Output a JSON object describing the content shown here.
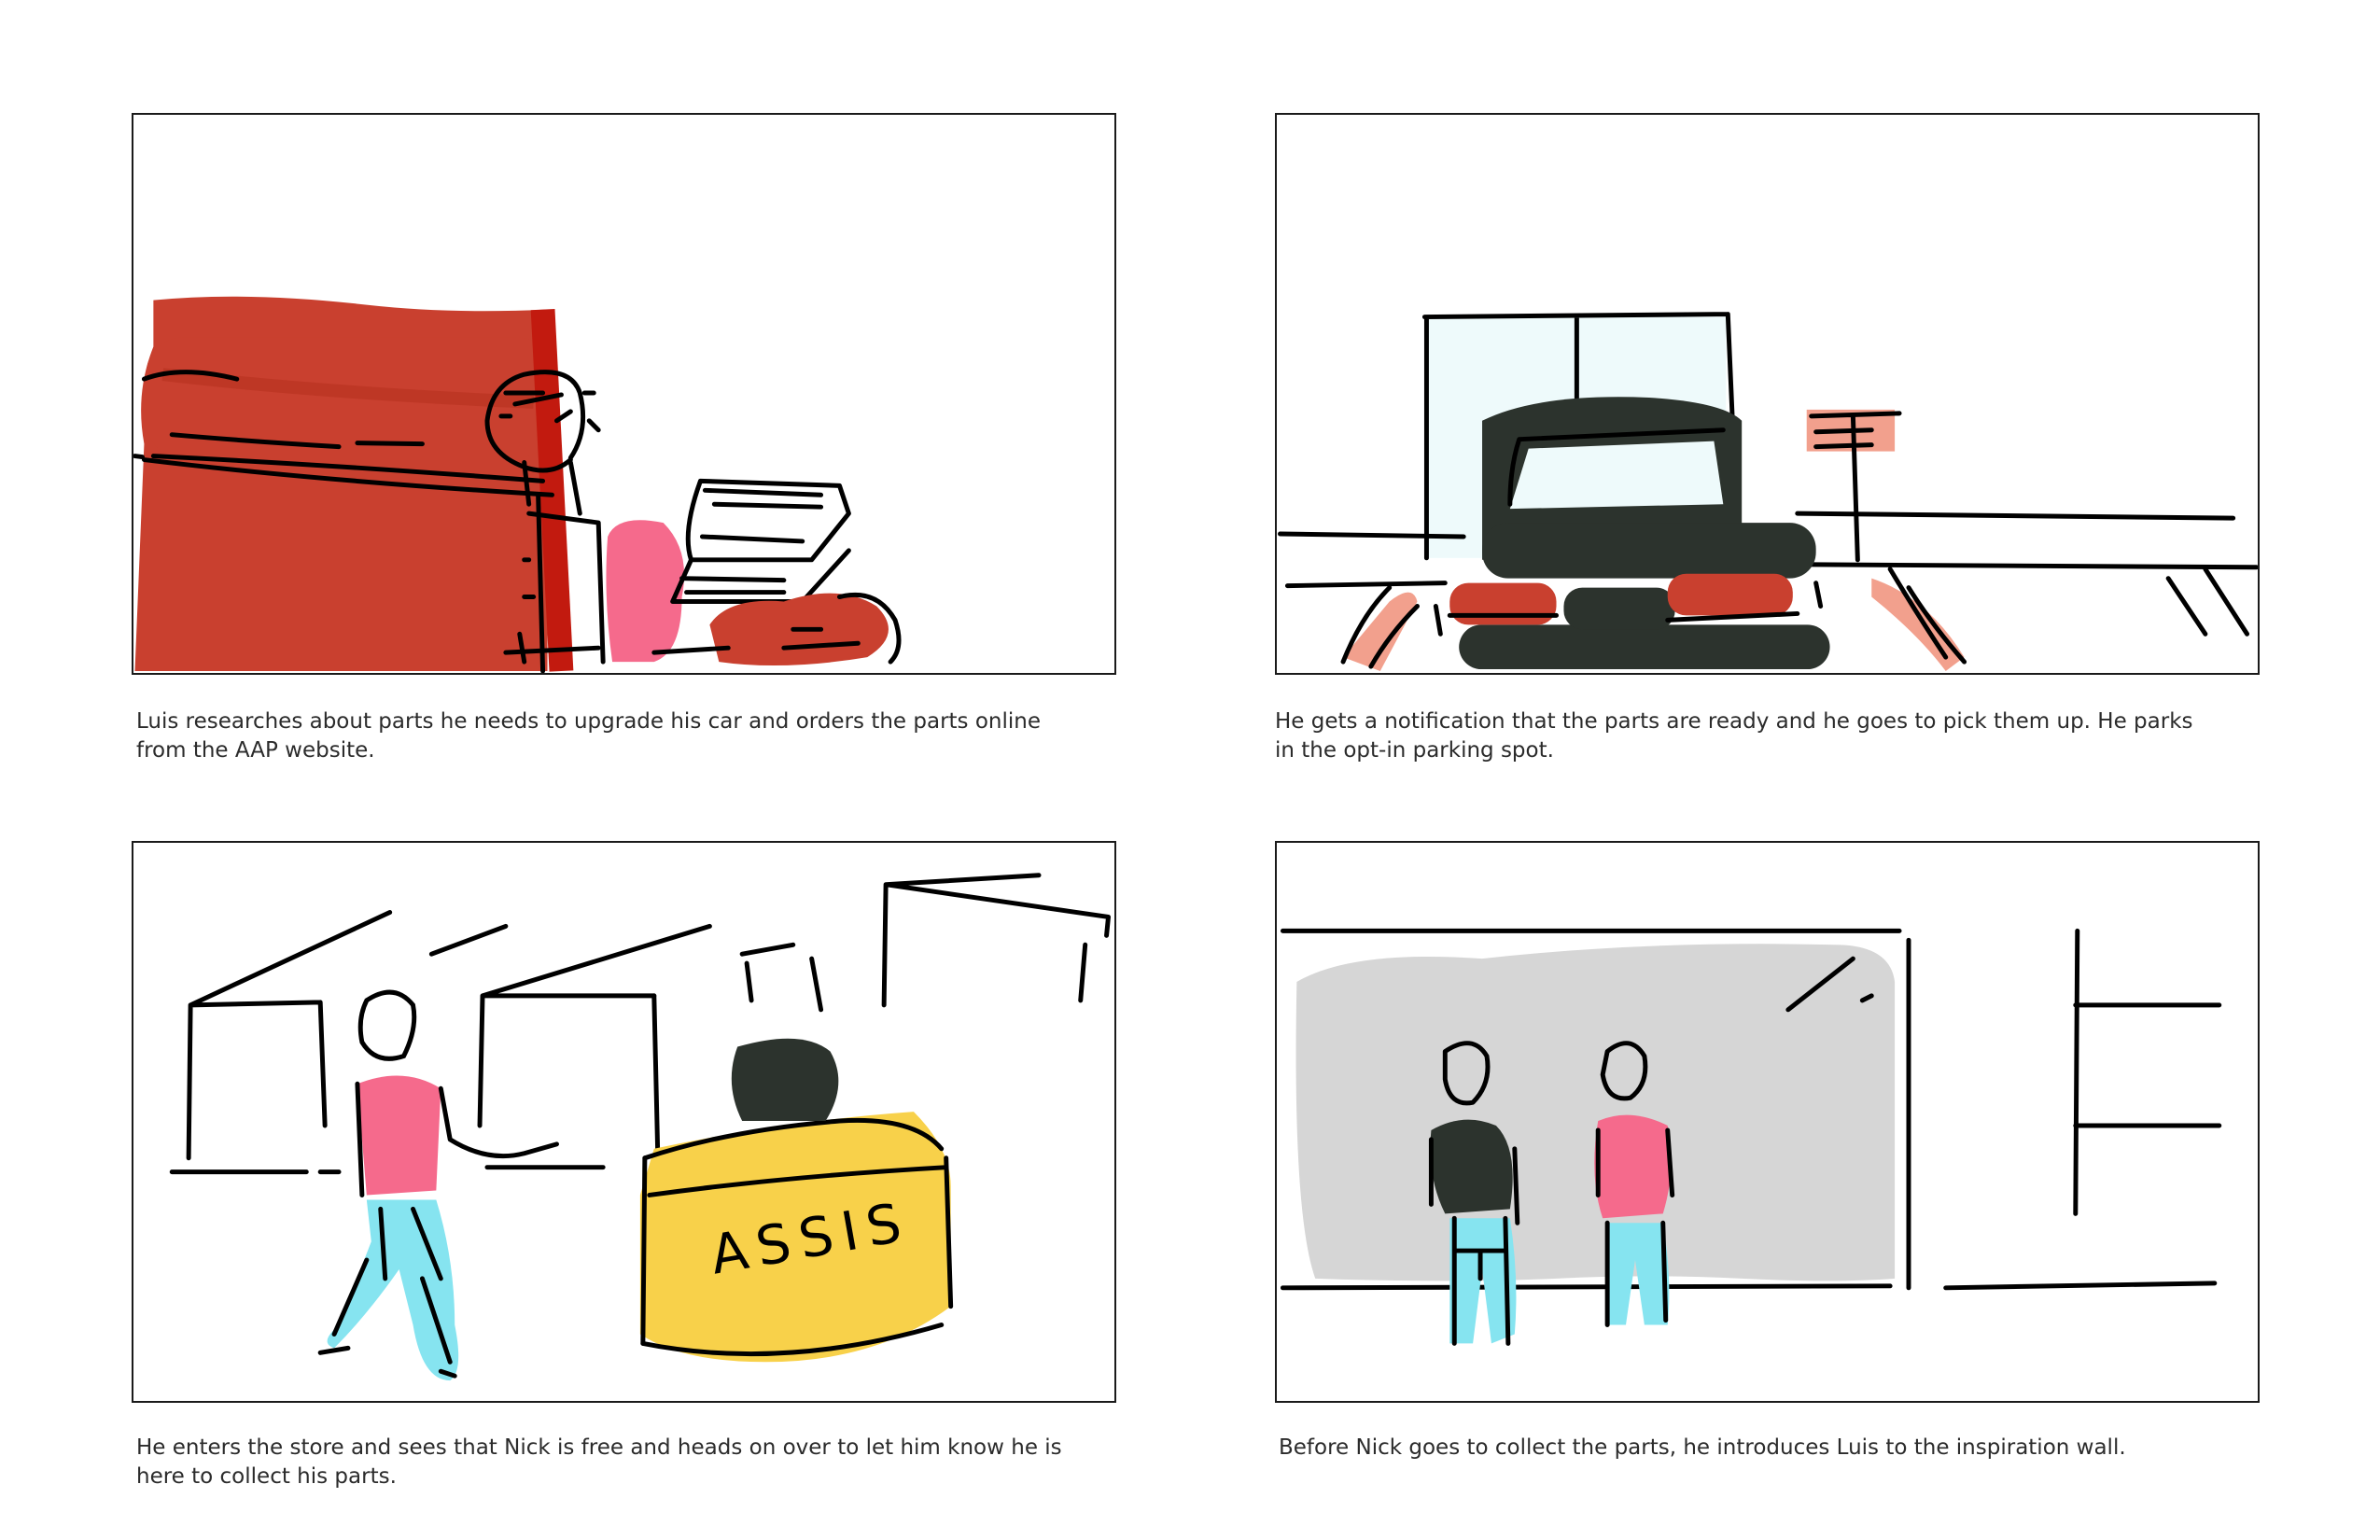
{
  "panels": [
    {
      "caption": "Luis researches about parts he needs to upgrade his car and orders the parts online from the AAP website."
    },
    {
      "caption": "He gets a notification that the parts are ready and he goes to pick them up. He parks in the opt-in parking spot."
    },
    {
      "caption": "He enters the store and sees that Nick is free and heads on over to let him know he is here to collect his parts.",
      "sign_text": "ASSIS"
    },
    {
      "caption": "Before Nick goes to collect the parts, he introduces Luis to the inspiration wall."
    }
  ],
  "colors": {
    "couch_red": "#c9402f",
    "shirt_pink": "#f56a8c",
    "dark_green": "#2c332d",
    "desk_yellow": "#f8d14a",
    "jeans_cyan": "#86e4f0",
    "wall_gray": "#d6d6d6",
    "salmon": "#f2a08d",
    "window_tint": "#eefafb"
  },
  "icons": {
    "panel1": "person-on-couch-with-laptop",
    "panel2": "car-in-parking-spot",
    "panel3": "person-walking-to-assistance-desk",
    "panel4": "two-people-at-inspiration-wall"
  }
}
